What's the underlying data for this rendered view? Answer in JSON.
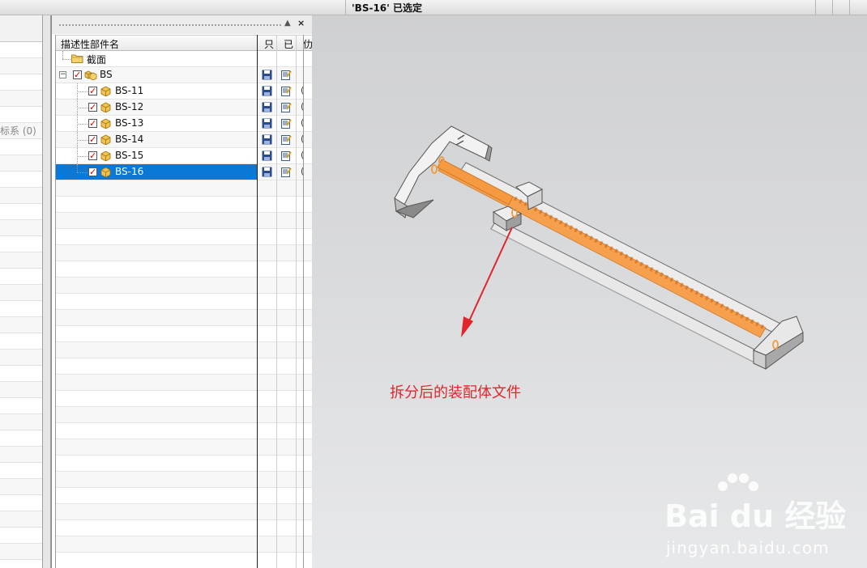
{
  "status_bar": {
    "text": "'BS-16' 已选定"
  },
  "left_panel": {
    "cut_label": "标系 (0)"
  },
  "navigator": {
    "columns": {
      "name": "描述性部件名",
      "readonly": "只",
      "modified": "已",
      "extra": "仂"
    },
    "rows": [
      {
        "label": "截面",
        "type": "folder",
        "selected": false
      },
      {
        "label": "BS",
        "type": "assembly",
        "selected": false,
        "last": ""
      },
      {
        "label": "BS-11",
        "type": "part",
        "selected": false,
        "last": "("
      },
      {
        "label": "BS-12",
        "type": "part",
        "selected": false,
        "last": "("
      },
      {
        "label": "BS-13",
        "type": "part",
        "selected": false,
        "last": "("
      },
      {
        "label": "BS-14",
        "type": "part",
        "selected": false,
        "last": "("
      },
      {
        "label": "BS-15",
        "type": "part",
        "selected": false,
        "last": "("
      },
      {
        "label": "BS-16",
        "type": "part",
        "selected": true,
        "last": "("
      }
    ]
  },
  "viewport": {
    "annotation": "拆分后的装配体文件",
    "watermark_main": "Bai du 经验",
    "watermark_sub": "jingyan.baidu.com"
  },
  "colors": {
    "selection": "#0a78d7",
    "annotation": "#e0262a",
    "highlight_part": "#f6a04d"
  }
}
